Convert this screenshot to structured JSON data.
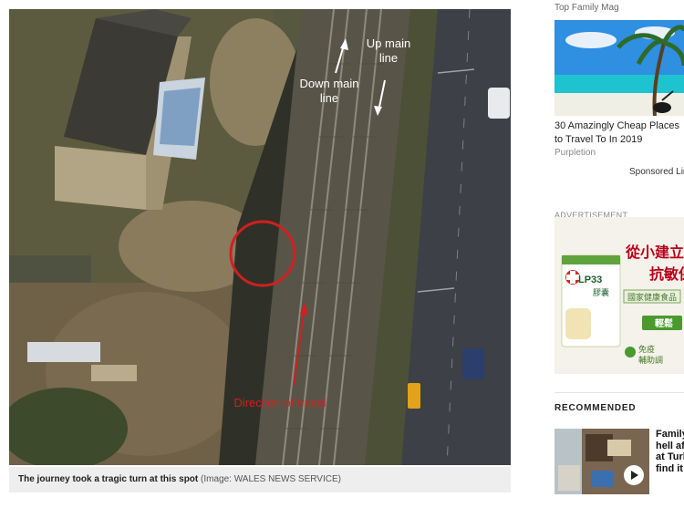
{
  "photo": {
    "labels": {
      "down_main_line": [
        "Down main",
        "line"
      ],
      "up_main_line": [
        "Up main",
        "line"
      ],
      "direction_of_travel": "Direction of travel"
    },
    "colors": {
      "annotation_red": "#d21f1f",
      "annotation_white": "#ffffff"
    }
  },
  "caption": {
    "main": "The journey took a tragic turn at this spot",
    "credit": "(Image: WALES NEWS SERVICE)"
  },
  "sidebar": {
    "promo": {
      "source_top": "Top Family Mag",
      "title": "30 Amazingly Cheap Places to Travel To In 2019",
      "source": "Purpletion",
      "sponsored": "Sponsored Links"
    },
    "advertisement": {
      "label": "ADVERTISEMENT",
      "headline_1": "從小建立",
      "headline_2": "抗敏保",
      "brand": "LP33",
      "brand_sub": "膠囊",
      "strip": "國家健康食品",
      "badge": "輕鬆",
      "bottom_1": "免疫",
      "bottom_2": "輔助調"
    },
    "recommended": {
      "label": "RECOMMENDED",
      "title_lines": [
        "Family",
        "hell af",
        "at Turk",
        "find it"
      ]
    }
  }
}
